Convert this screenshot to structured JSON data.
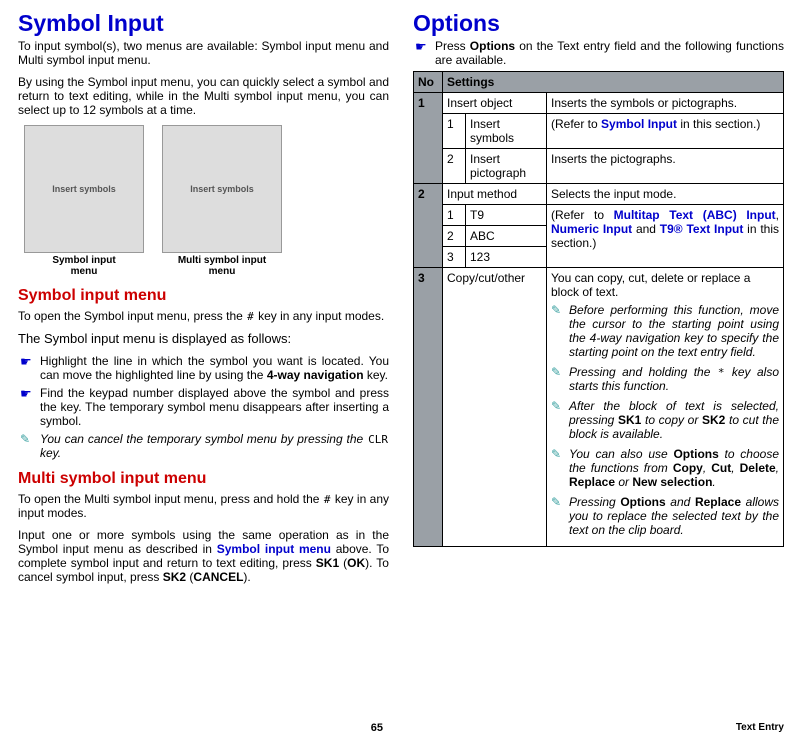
{
  "left": {
    "h1": "Symbol Input",
    "intro1": "To input symbol(s), two menus are available: Symbol input menu and Multi symbol input menu.",
    "intro2": "By using the Symbol input menu, you can quickly select a symbol and return to text editing, while in the Multi symbol input menu, you can select up to 12 symbols at a time.",
    "fig1_caption_a": "Symbol input",
    "fig1_caption_b": "menu",
    "fig2_caption_a": "Multi symbol input",
    "fig2_caption_b": "menu",
    "fig1_alt": "Insert symbols",
    "fig2_alt": "Insert symbols",
    "h2a": "Symbol input menu",
    "s1p1a": "To open the Symbol input menu, press the ",
    "s1p1_key": "#",
    "s1p1b": " key in any input modes.",
    "s1p2": "The Symbol input menu is displayed as follows:",
    "bul1a": "Highlight the line in which the symbol you want is located. You can move the highlighted line by using the ",
    "bul1b": "4-way navigation",
    "bul1c": " key.",
    "bul2": "Find the keypad number displayed above the symbol and press the key. The temporary symbol menu disappears after inserting a symbol.",
    "tip1a": "You can cancel the temporary symbol menu by pressing the ",
    "tip1_key": "CLR",
    "tip1b": " key.",
    "h2b": "Multi symbol input menu",
    "s2p1a": "To open the Multi symbol input menu, press and hold the ",
    "s2p1_key": "#",
    "s2p1b": " key in any input modes.",
    "s2p2a": "Input one or more symbols using the same operation as in the Symbol input menu as described in ",
    "s2p2_link": "Symbol input menu",
    "s2p2b": " above. To complete symbol input and return to text editing, press ",
    "s2p2c": "SK1",
    "s2p2d": " (",
    "s2p2e": "OK",
    "s2p2f": "). To cancel symbol input, press ",
    "s2p2g": "SK2",
    "s2p2h": " (",
    "s2p2i": "CANCEL",
    "s2p2j": ")."
  },
  "right": {
    "h1": "Options",
    "bul_a": "Press ",
    "bul_b": "Options",
    "bul_c": " on the Text entry field and the following functions are available.",
    "th_no": "No",
    "th_set": "Settings",
    "r1_no": "1",
    "r1_lab": "Insert object",
    "r1_desc": "Inserts the symbols or pictographs.",
    "r1s1_n": "1",
    "r1s1_lab": "Insert symbols",
    "r1s1_desc_a": "(Refer to ",
    "r1s1_desc_link": "Symbol Input",
    "r1s1_desc_b": " in this section.)",
    "r1s2_n": "2",
    "r1s2_lab": "Insert pictograph",
    "r1s2_desc": "Inserts the pictographs.",
    "r2_no": "2",
    "r2_lab": "Input method",
    "r2_desc": "Selects the input mode.",
    "r2s1_n": "1",
    "r2s1_lab": "T9",
    "r2s2_n": "2",
    "r2s2_lab": "ABC",
    "r2s3_n": "3",
    "r2s3_lab": "123",
    "r2s_desc_a": "(Refer to ",
    "r2s_desc_l1": "Multitap Text (ABC) Input",
    "r2s_desc_b": ", ",
    "r2s_desc_l2": "Numeric Input",
    "r2s_desc_c": " and ",
    "r2s_desc_l3": "T9® Text Input",
    "r2s_desc_d": " in this section.)",
    "r3_no": "3",
    "r3_lab": "Copy/cut/other",
    "r3_desc": "You can copy, cut, delete or replace a block of text.",
    "r3_t1": "Before performing this function, move the cursor to the starting point using the 4-way navigation key to specify the starting point on the text entry field.",
    "r3_t2a": "Pressing and holding the ",
    "r3_t2_key": "*",
    "r3_t2b": " key also starts this function.",
    "r3_t3a": "After the block of text is selected, pressing ",
    "r3_t3b": "SK1",
    "r3_t3c": " to copy or ",
    "r3_t3d": "SK2",
    "r3_t3e": " to cut the block is available.",
    "r3_t4a": "You can also use ",
    "r3_t4b": "Options",
    "r3_t4c": " to choose the functions from ",
    "r3_t4d": "Copy",
    "r3_t4e": ", ",
    "r3_t4f": "Cut",
    "r3_t4g": ", ",
    "r3_t4h": "Delete",
    "r3_t4i": ", ",
    "r3_t4j": "Replace",
    "r3_t4k": " or ",
    "r3_t4l": "New selection",
    "r3_t4m": ".",
    "r3_t5a": "Pressing ",
    "r3_t5b": "Options",
    "r3_t5c": " and ",
    "r3_t5d": "Replace",
    "r3_t5e": " allows you to replace the selected text by the text on the clip board."
  },
  "footer": {
    "page": "65",
    "section": "Text Entry"
  }
}
